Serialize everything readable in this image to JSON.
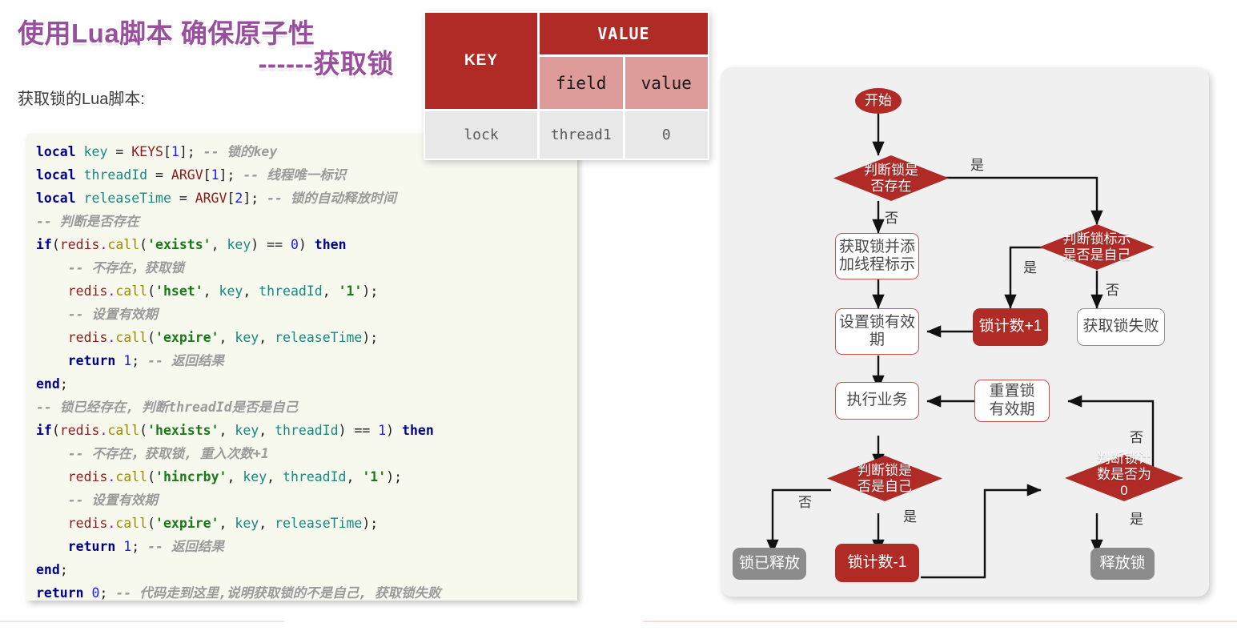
{
  "title": {
    "line1": "使用Lua脚本 确保原子性",
    "line2": "------获取锁",
    "subtitle": "获取锁的Lua脚本:",
    "accent_color": "#9a4f9e"
  },
  "kv_table": {
    "key_header": "KEY",
    "value_header": "VALUE",
    "sub_headers": [
      "field",
      "value"
    ],
    "rows": [
      {
        "key": "lock",
        "field": "thread1",
        "value": "0"
      }
    ],
    "header_color": "#b02a26",
    "sub_header_color": "#dd9b99",
    "cell_color": "#e8e8e8"
  },
  "code": {
    "language": "lua",
    "background": "#f7f9ef",
    "lines": [
      [
        {
          "t": "local",
          "c": "kw"
        },
        {
          "t": " key ",
          "c": "var"
        },
        {
          "t": "= ",
          "c": "pl"
        },
        {
          "t": "KEYS",
          "c": "id"
        },
        {
          "t": "[",
          "c": "pl"
        },
        {
          "t": "1",
          "c": "num"
        },
        {
          "t": "]; ",
          "c": "pl"
        },
        {
          "t": "-- 锁的key",
          "c": "cmt"
        }
      ],
      [
        {
          "t": "local",
          "c": "kw"
        },
        {
          "t": " threadId ",
          "c": "var"
        },
        {
          "t": "= ",
          "c": "pl"
        },
        {
          "t": "ARGV",
          "c": "id"
        },
        {
          "t": "[",
          "c": "pl"
        },
        {
          "t": "1",
          "c": "num"
        },
        {
          "t": "]; ",
          "c": "pl"
        },
        {
          "t": "-- 线程唯一标识",
          "c": "cmt"
        }
      ],
      [
        {
          "t": "local",
          "c": "kw"
        },
        {
          "t": " releaseTime ",
          "c": "var"
        },
        {
          "t": "= ",
          "c": "pl"
        },
        {
          "t": "ARGV",
          "c": "id"
        },
        {
          "t": "[",
          "c": "pl"
        },
        {
          "t": "2",
          "c": "num"
        },
        {
          "t": "]; ",
          "c": "pl"
        },
        {
          "t": "-- 锁的自动释放时间",
          "c": "cmt"
        }
      ],
      [
        {
          "t": "-- 判断是否存在",
          "c": "cmt"
        }
      ],
      [
        {
          "t": "if",
          "c": "kw"
        },
        {
          "t": "(",
          "c": "pl"
        },
        {
          "t": "redis",
          "c": "id"
        },
        {
          "t": ".",
          "c": "dot"
        },
        {
          "t": "call",
          "c": "fn"
        },
        {
          "t": "(",
          "c": "pl"
        },
        {
          "t": "'exists'",
          "c": "str"
        },
        {
          "t": ", ",
          "c": "pl"
        },
        {
          "t": "key",
          "c": "var"
        },
        {
          "t": ") == ",
          "c": "pl"
        },
        {
          "t": "0",
          "c": "num"
        },
        {
          "t": ") ",
          "c": "pl"
        },
        {
          "t": "then",
          "c": "kw"
        }
      ],
      [
        {
          "t": "    ",
          "c": "pl"
        },
        {
          "t": "-- 不存在，获取锁",
          "c": "cmt"
        }
      ],
      [
        {
          "t": "    ",
          "c": "pl"
        },
        {
          "t": "redis",
          "c": "id"
        },
        {
          "t": ".",
          "c": "dot"
        },
        {
          "t": "call",
          "c": "fn"
        },
        {
          "t": "(",
          "c": "pl"
        },
        {
          "t": "'hset'",
          "c": "str"
        },
        {
          "t": ", ",
          "c": "pl"
        },
        {
          "t": "key",
          "c": "var"
        },
        {
          "t": ", ",
          "c": "pl"
        },
        {
          "t": "threadId",
          "c": "var"
        },
        {
          "t": ", ",
          "c": "pl"
        },
        {
          "t": "'1'",
          "c": "str"
        },
        {
          "t": ");",
          "c": "pl"
        }
      ],
      [
        {
          "t": "    ",
          "c": "pl"
        },
        {
          "t": "-- 设置有效期",
          "c": "cmt"
        }
      ],
      [
        {
          "t": "    ",
          "c": "pl"
        },
        {
          "t": "redis",
          "c": "id"
        },
        {
          "t": ".",
          "c": "dot"
        },
        {
          "t": "call",
          "c": "fn"
        },
        {
          "t": "(",
          "c": "pl"
        },
        {
          "t": "'expire'",
          "c": "str"
        },
        {
          "t": ", ",
          "c": "pl"
        },
        {
          "t": "key",
          "c": "var"
        },
        {
          "t": ", ",
          "c": "pl"
        },
        {
          "t": "releaseTime",
          "c": "var"
        },
        {
          "t": ");",
          "c": "pl"
        }
      ],
      [
        {
          "t": "    ",
          "c": "pl"
        },
        {
          "t": "return",
          "c": "kw"
        },
        {
          "t": " ",
          "c": "pl"
        },
        {
          "t": "1",
          "c": "num"
        },
        {
          "t": "; ",
          "c": "pl"
        },
        {
          "t": "-- 返回结果",
          "c": "cmt"
        }
      ],
      [
        {
          "t": "end",
          "c": "kw"
        },
        {
          "t": ";",
          "c": "pl"
        }
      ],
      [
        {
          "t": "-- 锁已经存在, 判断threadId是否是自己",
          "c": "cmt"
        }
      ],
      [
        {
          "t": "if",
          "c": "kw"
        },
        {
          "t": "(",
          "c": "pl"
        },
        {
          "t": "redis",
          "c": "id"
        },
        {
          "t": ".",
          "c": "dot"
        },
        {
          "t": "call",
          "c": "fn"
        },
        {
          "t": "(",
          "c": "pl"
        },
        {
          "t": "'hexists'",
          "c": "str"
        },
        {
          "t": ", ",
          "c": "pl"
        },
        {
          "t": "key",
          "c": "var"
        },
        {
          "t": ", ",
          "c": "pl"
        },
        {
          "t": "threadId",
          "c": "var"
        },
        {
          "t": ") == ",
          "c": "pl"
        },
        {
          "t": "1",
          "c": "num"
        },
        {
          "t": ") ",
          "c": "pl"
        },
        {
          "t": "then",
          "c": "kw"
        }
      ],
      [
        {
          "t": "    ",
          "c": "pl"
        },
        {
          "t": "-- 不存在，获取锁, 重入次数+1",
          "c": "cmt"
        }
      ],
      [
        {
          "t": "    ",
          "c": "pl"
        },
        {
          "t": "redis",
          "c": "id"
        },
        {
          "t": ".",
          "c": "dot"
        },
        {
          "t": "call",
          "c": "fn"
        },
        {
          "t": "(",
          "c": "pl"
        },
        {
          "t": "'hincrby'",
          "c": "str"
        },
        {
          "t": ", ",
          "c": "pl"
        },
        {
          "t": "key",
          "c": "var"
        },
        {
          "t": ", ",
          "c": "pl"
        },
        {
          "t": "threadId",
          "c": "var"
        },
        {
          "t": ", ",
          "c": "pl"
        },
        {
          "t": "'1'",
          "c": "str"
        },
        {
          "t": ");",
          "c": "pl"
        }
      ],
      [
        {
          "t": "    ",
          "c": "pl"
        },
        {
          "t": "-- 设置有效期",
          "c": "cmt"
        }
      ],
      [
        {
          "t": "    ",
          "c": "pl"
        },
        {
          "t": "redis",
          "c": "id"
        },
        {
          "t": ".",
          "c": "dot"
        },
        {
          "t": "call",
          "c": "fn"
        },
        {
          "t": "(",
          "c": "pl"
        },
        {
          "t": "'expire'",
          "c": "str"
        },
        {
          "t": ", ",
          "c": "pl"
        },
        {
          "t": "key",
          "c": "var"
        },
        {
          "t": ", ",
          "c": "pl"
        },
        {
          "t": "releaseTime",
          "c": "var"
        },
        {
          "t": ");",
          "c": "pl"
        }
      ],
      [
        {
          "t": "    ",
          "c": "pl"
        },
        {
          "t": "return",
          "c": "kw"
        },
        {
          "t": " ",
          "c": "pl"
        },
        {
          "t": "1",
          "c": "num"
        },
        {
          "t": "; ",
          "c": "pl"
        },
        {
          "t": "-- 返回结果",
          "c": "cmt"
        }
      ],
      [
        {
          "t": "end",
          "c": "kw"
        },
        {
          "t": ";",
          "c": "pl"
        }
      ],
      [
        {
          "t": "return",
          "c": "kw"
        },
        {
          "t": " ",
          "c": "pl"
        },
        {
          "t": "0",
          "c": "num"
        },
        {
          "t": "; ",
          "c": "pl"
        },
        {
          "t": "-- 代码走到这里,说明获取锁的不是自己, 获取锁失败",
          "c": "cmt"
        }
      ]
    ]
  },
  "flowchart": {
    "nodes": {
      "start": "开始",
      "check_exists": "判断锁是\n否存在",
      "acquire_add_thread": "获取锁并添\n加线程标示",
      "set_expire": "设置锁有效\n期",
      "check_is_self": "判断锁标示\n是否是自己",
      "lock_count_plus": "锁计数+1",
      "acquire_fail": "获取锁失败",
      "do_business": "执行业务",
      "reset_expire": "重置锁\n有效期",
      "check_owner": "判断锁是\n否是自己",
      "check_count_zero": "判断锁计\n数是否为\n0",
      "lock_released": "锁已释放",
      "lock_count_minus": "锁计数-1",
      "release_lock": "释放锁"
    },
    "edge_labels": {
      "exists_yes": "是",
      "exists_no": "否",
      "is_self_yes": "是",
      "is_self_no": "否",
      "owner_no": "否",
      "owner_yes": "是",
      "count_no": "否",
      "count_yes": "是"
    },
    "colors": {
      "red": "#b02a26",
      "gray": "#8c8c8c",
      "panel": "#f0f0f0"
    }
  }
}
